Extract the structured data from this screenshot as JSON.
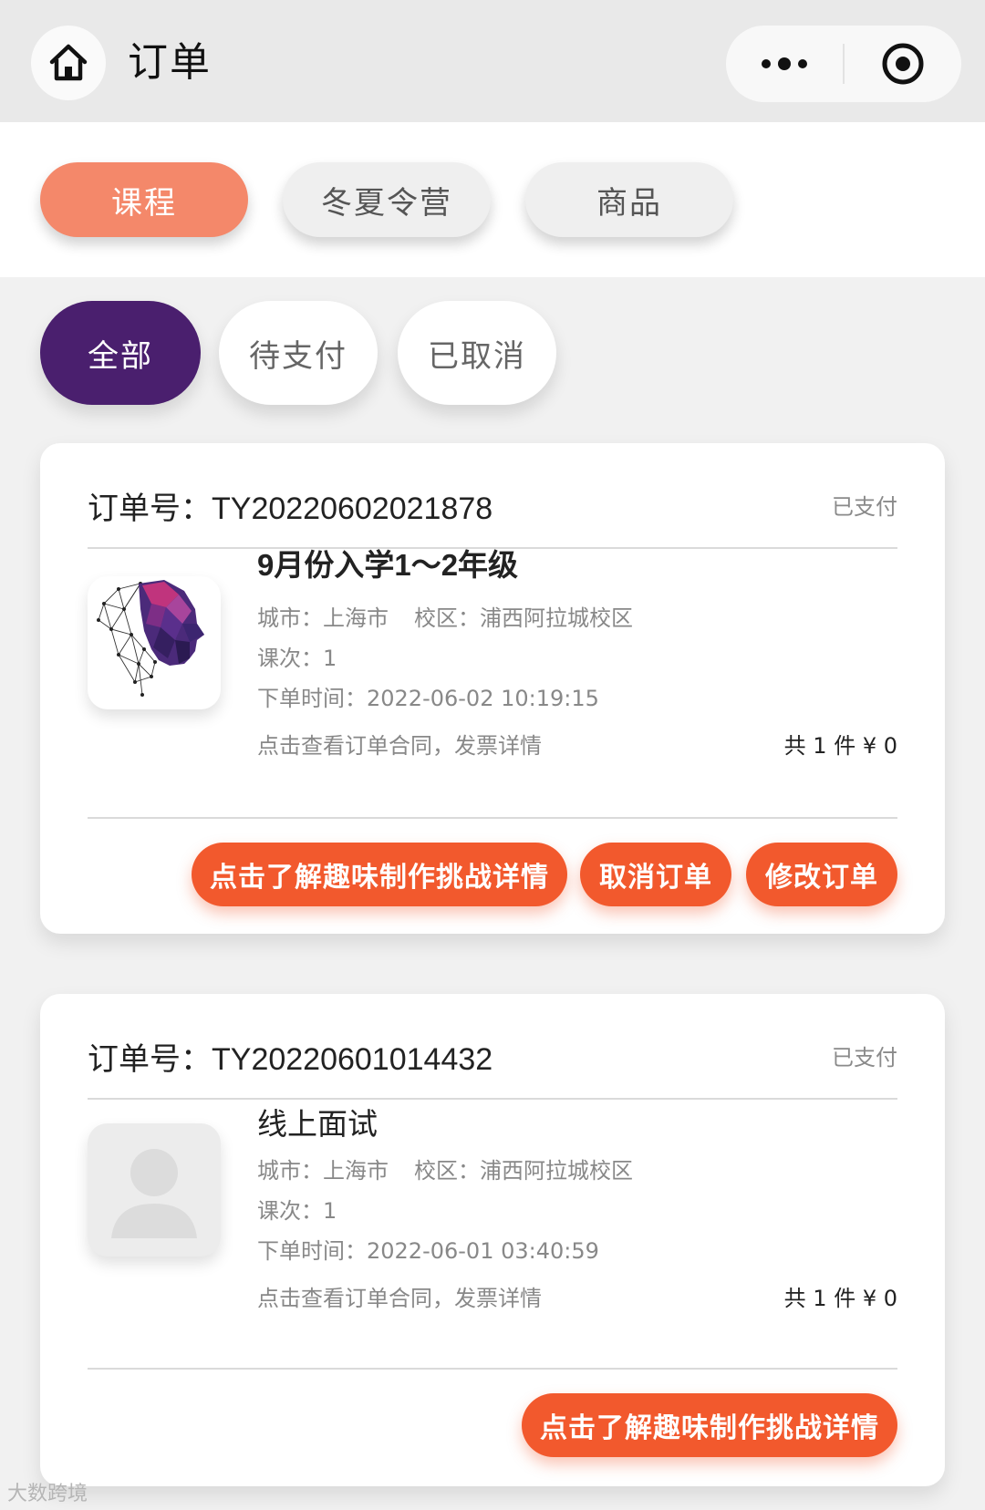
{
  "header": {
    "title": "订单",
    "home_icon": "home-icon",
    "more_icon": "more-dots-icon",
    "target_icon": "record-target-icon"
  },
  "category_tabs": [
    {
      "label": "课程",
      "active": true
    },
    {
      "label": "冬夏令营",
      "active": false
    },
    {
      "label": "商品",
      "active": false
    }
  ],
  "status_filters": [
    {
      "label": "全部",
      "active": true
    },
    {
      "label": "待支付",
      "active": false
    },
    {
      "label": "已取消",
      "active": false
    }
  ],
  "orders": [
    {
      "order_no": "订单号：TY20220602021878",
      "status": "已支付",
      "title": "9月份入学1～2年级",
      "city": "城市：上海市",
      "campus": "校区：浦西阿拉城校区",
      "lessons": "课次：1",
      "order_time": "下单时间：2022-06-02 10:19:15",
      "contract_link": "点击查看订单合同，发票详情",
      "total": "共 1 件 ¥ 0",
      "thumbnail": "polygon-head-image",
      "actions": [
        "点击了解趣味制作挑战详情",
        "取消订单",
        "修改订单"
      ]
    },
    {
      "order_no": "订单号：TY20220601014432",
      "status": "已支付",
      "title": "线上面试",
      "city": "城市：上海市",
      "campus": "校区：浦西阿拉城校区",
      "lessons": "课次：1",
      "order_time": "下单时间：2022-06-01 03:40:59",
      "contract_link": "点击查看订单合同，发票详情",
      "total": "共 1 件 ¥ 0",
      "thumbnail": "user-placeholder-icon",
      "actions": [
        "点击了解趣味制作挑战详情"
      ]
    }
  ],
  "watermark": "大数跨境",
  "colors": {
    "category_active": "#f4886a",
    "status_active": "#4a1f6e",
    "action_button": "#f2592d"
  }
}
